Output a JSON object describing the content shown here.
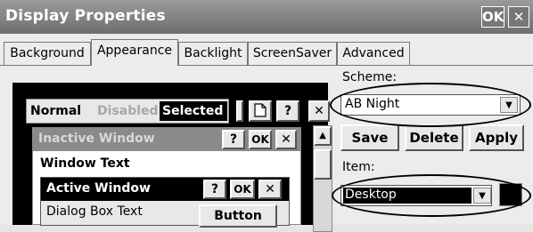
{
  "window": {
    "title": "Display Properties",
    "ok_label": "OK",
    "close_label": "✕"
  },
  "tabs": [
    {
      "label": "Background"
    },
    {
      "label": "Appearance"
    },
    {
      "label": "Backlight"
    },
    {
      "label": "ScreenSaver"
    },
    {
      "label": "Advanced"
    }
  ],
  "preview": {
    "normal": "Normal",
    "disabled": "Disabled",
    "selected": "Selected",
    "help": "?",
    "close": "✕",
    "inactive_window": "Inactive Window",
    "window_text": "Window Text",
    "active_window": "Active Window",
    "ok": "OK",
    "dialog_box_text": "Dialog Box Text",
    "button": "Button"
  },
  "scheme": {
    "label": "Scheme:",
    "value": "AB Night"
  },
  "actions": {
    "save": "Save",
    "delete": "Delete",
    "apply": "Apply"
  },
  "item": {
    "label": "Item:",
    "value": "Desktop"
  },
  "colors": {
    "titlebar": "#777777",
    "selection": "#000000",
    "inactive_title": "#8a8a8a"
  }
}
